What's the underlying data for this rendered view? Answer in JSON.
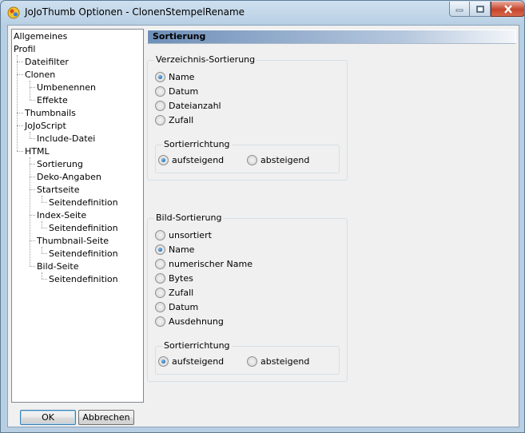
{
  "window": {
    "title": "JoJoThumb Optionen - ClonenStempelRename",
    "controls": [
      "minimize-icon",
      "maximize-icon",
      "close-icon"
    ]
  },
  "tree": {
    "items": [
      {
        "label": "Allgemeines",
        "level": 0
      },
      {
        "label": "Profil",
        "level": 0
      },
      {
        "label": "Dateifilter",
        "level": 1
      },
      {
        "label": "Clonen",
        "level": 1
      },
      {
        "label": "Umbenennen",
        "level": 2
      },
      {
        "label": "Effekte",
        "level": 2
      },
      {
        "label": "Thumbnails",
        "level": 1
      },
      {
        "label": "JoJoScript",
        "level": 1
      },
      {
        "label": "Include-Datei",
        "level": 2
      },
      {
        "label": "HTML",
        "level": 1
      },
      {
        "label": "Sortierung",
        "level": 2
      },
      {
        "label": "Deko-Angaben",
        "level": 2
      },
      {
        "label": "Startseite",
        "level": 2
      },
      {
        "label": "Seitendefinition",
        "level": 3
      },
      {
        "label": "Index-Seite",
        "level": 2
      },
      {
        "label": "Seitendefinition",
        "level": 3
      },
      {
        "label": "Thumbnail-Seite",
        "level": 2
      },
      {
        "label": "Seitendefinition",
        "level": 3
      },
      {
        "label": "Bild-Seite",
        "level": 2
      },
      {
        "label": "Seitendefinition",
        "level": 3
      }
    ]
  },
  "section": {
    "title": "Sortierung"
  },
  "dir_sort": {
    "label": "Verzeichnis-Sortierung",
    "options": [
      "Name",
      "Datum",
      "Dateianzahl",
      "Zufall"
    ],
    "selected": "Name",
    "direction": {
      "label": "Sortierrichtung",
      "options": [
        "aufsteigend",
        "absteigend"
      ],
      "selected": "aufsteigend"
    }
  },
  "img_sort": {
    "label": "Bild-Sortierung",
    "options": [
      "unsortiert",
      "Name",
      "numerischer Name",
      "Bytes",
      "Zufall",
      "Datum",
      "Ausdehnung"
    ],
    "selected": "Name",
    "direction": {
      "label": "Sortierrichtung",
      "options": [
        "aufsteigend",
        "absteigend"
      ],
      "selected": "aufsteigend"
    }
  },
  "buttons": {
    "ok": "OK",
    "cancel": "Abbrechen"
  },
  "colors": {
    "header_gradient_start": "#6e8fb8",
    "selected_radio": "#1b5fa8"
  }
}
